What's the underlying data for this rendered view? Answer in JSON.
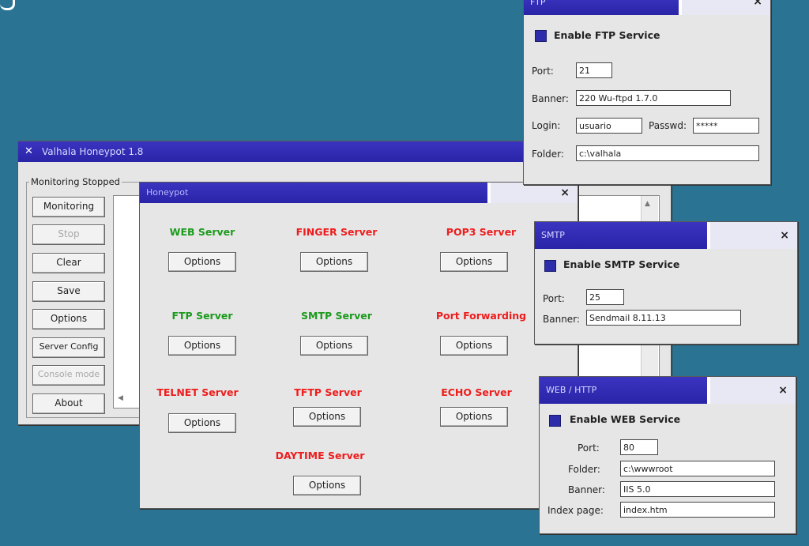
{
  "valhala": {
    "title": "Valhala Honeypot 1.8",
    "group_label": "Monitoring Stopped",
    "close_glyph": "x",
    "buttons": [
      {
        "label": "Monitoring",
        "disabled": false
      },
      {
        "label": "Stop",
        "disabled": true
      },
      {
        "label": "Clear",
        "disabled": false
      },
      {
        "label": "Save",
        "disabled": false
      },
      {
        "label": "Options",
        "disabled": false
      },
      {
        "label": "Server Config",
        "disabled": false
      },
      {
        "label": "Console mode",
        "disabled": true
      },
      {
        "label": "About",
        "disabled": false
      }
    ]
  },
  "honeypot": {
    "title": "Honeypot",
    "close_glyph": "×",
    "options_label": "Options",
    "servers": [
      {
        "label": "WEB Server",
        "color": "green"
      },
      {
        "label": "FINGER Server",
        "color": "red"
      },
      {
        "label": "POP3 Server",
        "color": "red"
      },
      {
        "label": "FTP Server",
        "color": "green"
      },
      {
        "label": "SMTP Server",
        "color": "green"
      },
      {
        "label": "Port Forwarding",
        "color": "red"
      },
      {
        "label": "TELNET Server",
        "color": "red"
      },
      {
        "label": "TFTP Server",
        "color": "red"
      },
      {
        "label": "ECHO Server",
        "color": "red"
      },
      {
        "label": "DAYTIME Server",
        "color": "red"
      }
    ]
  },
  "ftp": {
    "title": "FTP",
    "close_glyph": "×",
    "enable_label": "Enable FTP Service",
    "port_label": "Port:",
    "port_value": "21",
    "banner_label": "Banner:",
    "banner_value": "220 Wu-ftpd 1.7.0",
    "login_label": "Login:",
    "login_value": "usuario",
    "passwd_label": "Passwd:",
    "passwd_value": "*****",
    "folder_label": "Folder:",
    "folder_value": "c:\\valhala"
  },
  "smtp": {
    "title": "SMTP",
    "close_glyph": "×",
    "enable_label": "Enable SMTP Service",
    "port_label": "Port:",
    "port_value": "25",
    "banner_label": "Banner:",
    "banner_value": "Sendmail 8.11.13"
  },
  "web": {
    "title": "WEB / HTTP",
    "close_glyph": "×",
    "enable_label": "Enable WEB Service",
    "port_label": "Port:",
    "port_value": "80",
    "folder_label": "Folder:",
    "folder_value": "c:\\wwwroot",
    "banner_label": "Banner:",
    "banner_value": "IIS 5.0",
    "index_label": "Index page:",
    "index_value": "index.htm"
  },
  "colors": {
    "desktop": "#2a7393",
    "title_blue": "#2a24a8",
    "enable_check": "#2d2dab"
  }
}
